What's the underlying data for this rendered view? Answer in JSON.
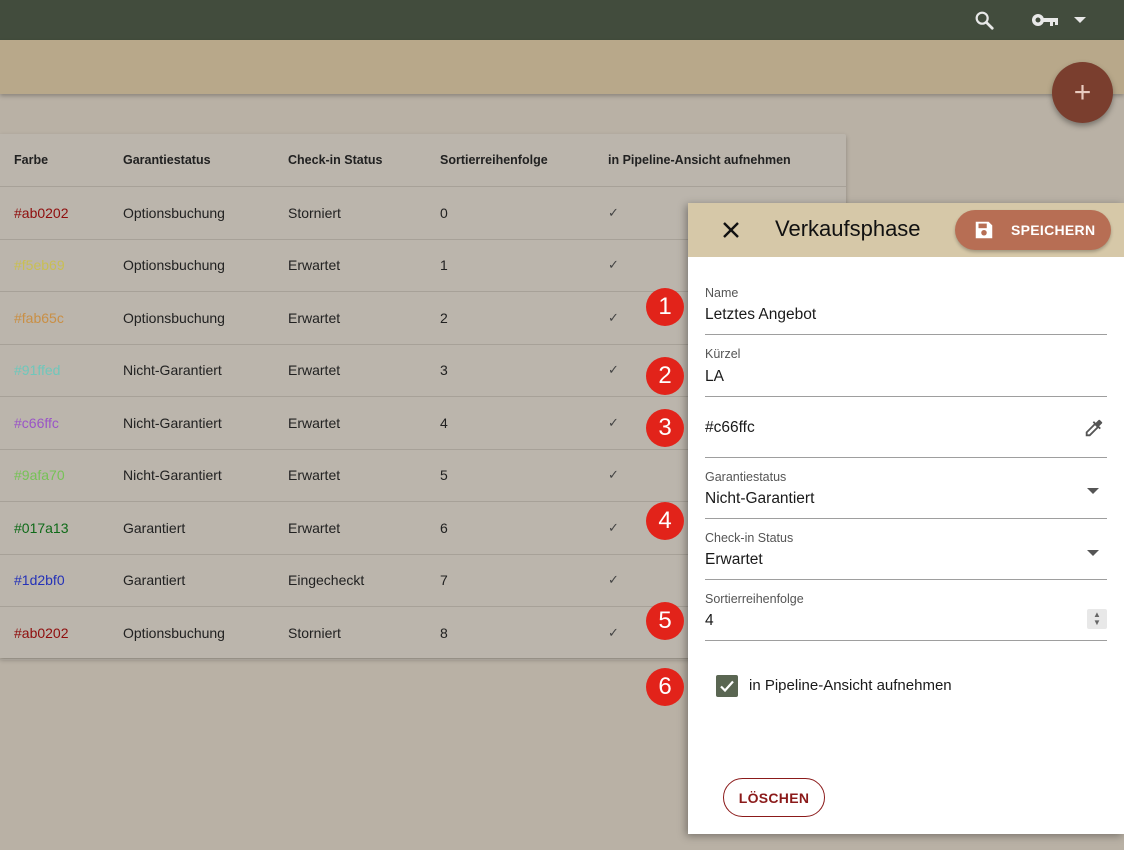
{
  "colors": {
    "topbar": "#424c3d",
    "subbar": "#b8a88a",
    "fab": "#7a3e2e",
    "panel_header": "#d6c8a8",
    "save_button": "#b76e54",
    "delete_button": "#8b1a1a",
    "checkbox": "#5a6652",
    "marker": "#e2231a"
  },
  "topbar": {
    "icons": [
      "search-icon",
      "key-icon",
      "arrow-drop-down-icon"
    ]
  },
  "fab": {
    "icon": "plus-icon",
    "label": "+"
  },
  "table": {
    "headers": [
      "Farbe",
      "Garantiestatus",
      "Check-in Status",
      "Sortierreihenfolge",
      "in Pipeline-Ansicht aufnehmen"
    ],
    "rows": [
      {
        "farbe": "#ab0202",
        "color": "#8f0d0d",
        "garantie": "Optionsbuchung",
        "checkin": "Storniert",
        "sort": "0",
        "pipeline": "✓"
      },
      {
        "farbe": "#f5eb69",
        "color": "#c9bf53",
        "garantie": "Optionsbuchung",
        "checkin": "Erwartet",
        "sort": "1",
        "pipeline": "✓"
      },
      {
        "farbe": "#fab65c",
        "color": "#c98f45",
        "garantie": "Optionsbuchung",
        "checkin": "Erwartet",
        "sort": "2",
        "pipeline": "✓"
      },
      {
        "farbe": "#91ffed",
        "color": "#6fc7bb",
        "garantie": "Nicht-Garantiert",
        "checkin": "Erwartet",
        "sort": "3",
        "pipeline": "✓"
      },
      {
        "farbe": "#c66ffc",
        "color": "#9a55c6",
        "garantie": "Nicht-Garantiert",
        "checkin": "Erwartet",
        "sort": "4",
        "pipeline": "✓"
      },
      {
        "farbe": "#9afa70",
        "color": "#76c256",
        "garantie": "Nicht-Garantiert",
        "checkin": "Erwartet",
        "sort": "5",
        "pipeline": "✓"
      },
      {
        "farbe": "#017a13",
        "color": "#0e6a18",
        "garantie": "Garantiert",
        "checkin": "Erwartet",
        "sort": "6",
        "pipeline": "✓"
      },
      {
        "farbe": "#1d2bf0",
        "color": "#2532b8",
        "garantie": "Garantiert",
        "checkin": "Eingecheckt",
        "sort": "7",
        "pipeline": "✓"
      },
      {
        "farbe": "#ab0202",
        "color": "#8f0d0d",
        "garantie": "Optionsbuchung",
        "checkin": "Storniert",
        "sort": "8",
        "pipeline": "✓"
      }
    ]
  },
  "panel": {
    "title": "Verkaufsphase",
    "close_icon": "close-icon",
    "save_label": "SPEICHERN",
    "save_icon": "save-icon",
    "name": {
      "label": "Name",
      "value": "Letztes Angebot"
    },
    "kuerzel": {
      "label": "Kürzel",
      "value": "LA"
    },
    "color": {
      "value": "#c66ffc",
      "icon": "eyedropper-icon"
    },
    "garantiestatus": {
      "label": "Garantiestatus",
      "value": "Nicht-Garantiert"
    },
    "checkin": {
      "label": "Check-in Status",
      "value": "Erwartet"
    },
    "sortierung": {
      "label": "Sortierreihenfolge",
      "value": "4"
    },
    "pipeline": {
      "label": "in Pipeline-Ansicht aufnehmen",
      "checked": true
    },
    "delete_label": "LÖSCHEN"
  },
  "markers": [
    "1",
    "2",
    "3",
    "4",
    "5",
    "6"
  ]
}
